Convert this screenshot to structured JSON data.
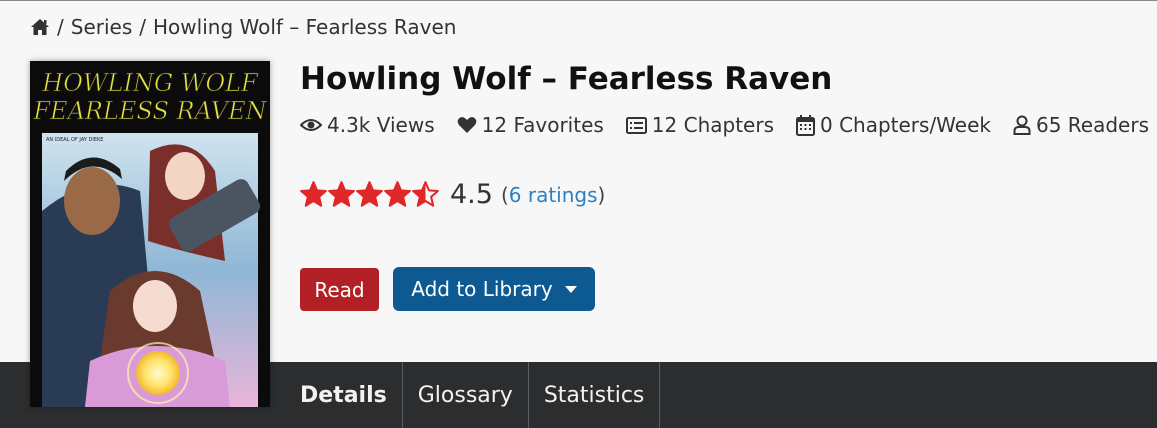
{
  "breadcrumb": {
    "home_icon": "home-icon",
    "separator": "/",
    "items": [
      "Series",
      "Howling Wolf – Fearless Raven"
    ]
  },
  "series": {
    "title": "Howling Wolf – Fearless Raven",
    "cover": {
      "title_line1": "HOWLING WOLF",
      "title_line2": "FEARLESS RAVEN",
      "byline": "AN IDEAL OF JAY DIEKE"
    },
    "stats": [
      {
        "icon": "eye-icon",
        "label": "4.3k Views"
      },
      {
        "icon": "heart-icon",
        "label": "12 Favorites"
      },
      {
        "icon": "list-icon",
        "label": "12 Chapters"
      },
      {
        "icon": "calendar-icon",
        "label": "0 Chapters/Week"
      },
      {
        "icon": "user-icon",
        "label": "65 Readers"
      }
    ],
    "rating": {
      "value": "4.5",
      "stars": 4.5,
      "open_paren": "(",
      "count_link": "6 ratings",
      "close_paren": ")"
    }
  },
  "actions": {
    "read_label": "Read",
    "library_label": "Add to Library"
  },
  "tabs": [
    {
      "label": "Details",
      "active": true
    },
    {
      "label": "Glossary",
      "active": false
    },
    {
      "label": "Statistics",
      "active": false
    }
  ],
  "colors": {
    "star": "#e0272a",
    "read_button": "#b21f24",
    "library_button": "#0d5a92",
    "tabbar": "#2b2d2f",
    "link": "#2f80c2"
  }
}
